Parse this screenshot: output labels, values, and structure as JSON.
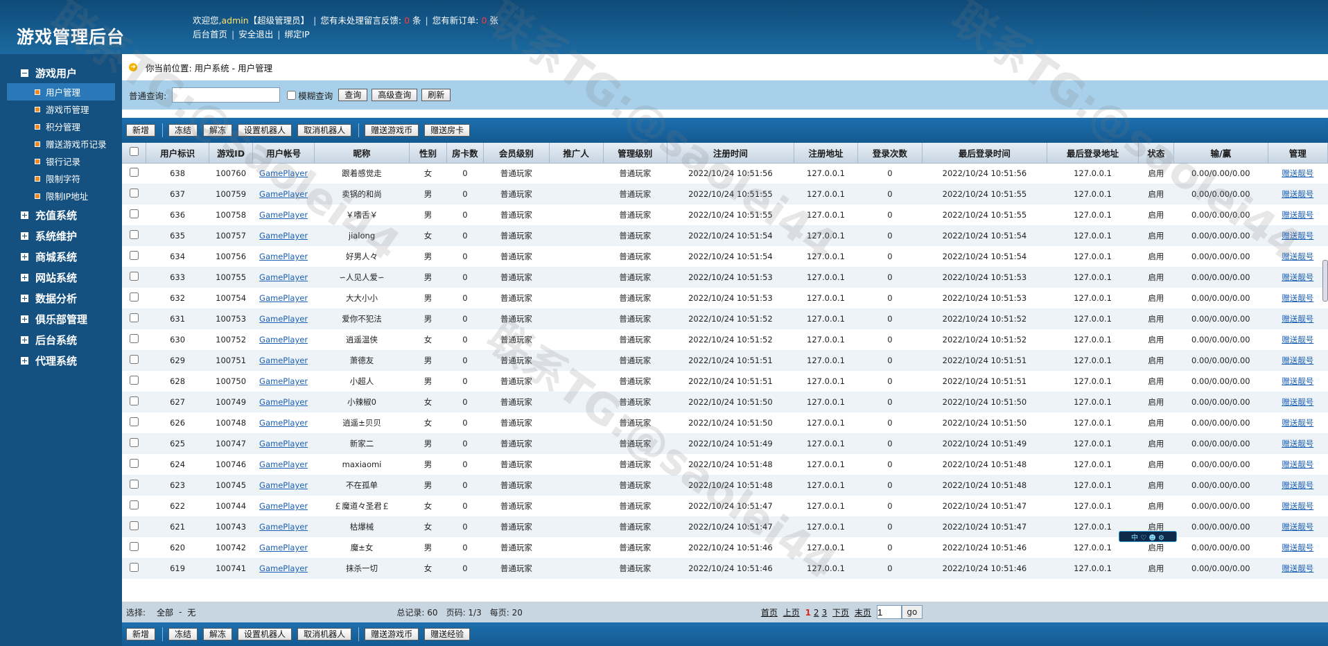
{
  "app_title": "游戏管理后台",
  "topbar": {
    "welcome_prefix": "欢迎您,",
    "username": "admin",
    "role": "【超级管理员】",
    "pending_prefix": "您有未处理留言反馈:",
    "pending_count": "0",
    "pending_unit": "条",
    "orders_prefix": "您有新订单:",
    "orders_count": "0",
    "orders_unit": "张",
    "links": [
      "后台首页",
      "安全退出",
      "绑定IP"
    ]
  },
  "sidebar": {
    "groups": [
      {
        "label": "游戏用户",
        "expanded": true,
        "items": [
          "用户管理",
          "游戏币管理",
          "积分管理",
          "赠送游戏币记录",
          "银行记录",
          "限制字符",
          "限制IP地址"
        ]
      },
      {
        "label": "充值系统",
        "expanded": false
      },
      {
        "label": "系统维护",
        "expanded": false
      },
      {
        "label": "商城系统",
        "expanded": false
      },
      {
        "label": "网站系统",
        "expanded": false
      },
      {
        "label": "数据分析",
        "expanded": false
      },
      {
        "label": "俱乐部管理",
        "expanded": false
      },
      {
        "label": "后台系统",
        "expanded": false
      },
      {
        "label": "代理系统",
        "expanded": false
      }
    ],
    "active_item": "用户管理"
  },
  "breadcrumb": "你当前位置: 用户系统 - 用户管理",
  "search": {
    "label": "普通查询:",
    "value": "",
    "fuzzy_label": "模糊查询",
    "buttons": [
      "查询",
      "高级查询",
      "刷新"
    ]
  },
  "toolbar_top": {
    "left": [
      "新增"
    ],
    "mid": [
      "冻结",
      "解冻",
      "设置机器人",
      "取消机器人"
    ],
    "right": [
      "赠送游戏币",
      "赠送房卡"
    ]
  },
  "toolbar_bottom": {
    "left": [
      "新增"
    ],
    "mid": [
      "冻结",
      "解冻",
      "设置机器人",
      "取消机器人"
    ],
    "right": [
      "赠送游戏币",
      "赠送经验"
    ]
  },
  "table": {
    "columns": [
      "",
      "用户标识",
      "游戏ID",
      "用户帐号",
      "昵称",
      "性别",
      "房卡数",
      "会员级别",
      "推广人",
      "管理级别",
      "注册时间",
      "注册地址",
      "登录次数",
      "最后登录时间",
      "最后登录地址",
      "状态",
      "输/赢",
      "管理"
    ],
    "rows": [
      [
        "638",
        "100760",
        "GamePlayer",
        "跟着感觉走",
        "女",
        "0",
        "普通玩家",
        "",
        "普通玩家",
        "2022/10/24 10:51:56",
        "127.0.0.1",
        "0",
        "2022/10/24 10:51:56",
        "127.0.0.1",
        "启用",
        "0.00/0.00/0.00",
        "赠送靓号"
      ],
      [
        "637",
        "100759",
        "GamePlayer",
        "卖锅的和尚",
        "男",
        "0",
        "普通玩家",
        "",
        "普通玩家",
        "2022/10/24 10:51:55",
        "127.0.0.1",
        "0",
        "2022/10/24 10:51:55",
        "127.0.0.1",
        "启用",
        "0.00/0.00/0.00",
        "赠送靓号"
      ],
      [
        "636",
        "100758",
        "GamePlayer",
        "￥嗜舌￥",
        "男",
        "0",
        "普通玩家",
        "",
        "普通玩家",
        "2022/10/24 10:51:55",
        "127.0.0.1",
        "0",
        "2022/10/24 10:51:55",
        "127.0.0.1",
        "启用",
        "0.00/0.00/0.00",
        "赠送靓号"
      ],
      [
        "635",
        "100757",
        "GamePlayer",
        "jialong",
        "女",
        "0",
        "普通玩家",
        "",
        "普通玩家",
        "2022/10/24 10:51:54",
        "127.0.0.1",
        "0",
        "2022/10/24 10:51:54",
        "127.0.0.1",
        "启用",
        "0.00/0.00/0.00",
        "赠送靓号"
      ],
      [
        "634",
        "100756",
        "GamePlayer",
        "好男人々",
        "男",
        "0",
        "普通玩家",
        "",
        "普通玩家",
        "2022/10/24 10:51:54",
        "127.0.0.1",
        "0",
        "2022/10/24 10:51:54",
        "127.0.0.1",
        "启用",
        "0.00/0.00/0.00",
        "赠送靓号"
      ],
      [
        "633",
        "100755",
        "GamePlayer",
        "∽人见人爱∽",
        "男",
        "0",
        "普通玩家",
        "",
        "普通玩家",
        "2022/10/24 10:51:53",
        "127.0.0.1",
        "0",
        "2022/10/24 10:51:53",
        "127.0.0.1",
        "启用",
        "0.00/0.00/0.00",
        "赠送靓号"
      ],
      [
        "632",
        "100754",
        "GamePlayer",
        "大大小小",
        "男",
        "0",
        "普通玩家",
        "",
        "普通玩家",
        "2022/10/24 10:51:53",
        "127.0.0.1",
        "0",
        "2022/10/24 10:51:53",
        "127.0.0.1",
        "启用",
        "0.00/0.00/0.00",
        "赠送靓号"
      ],
      [
        "631",
        "100753",
        "GamePlayer",
        "爱你不犯法",
        "男",
        "0",
        "普通玩家",
        "",
        "普通玩家",
        "2022/10/24 10:51:52",
        "127.0.0.1",
        "0",
        "2022/10/24 10:51:52",
        "127.0.0.1",
        "启用",
        "0.00/0.00/0.00",
        "赠送靓号"
      ],
      [
        "630",
        "100752",
        "GamePlayer",
        "逍遥温侠",
        "女",
        "0",
        "普通玩家",
        "",
        "普通玩家",
        "2022/10/24 10:51:52",
        "127.0.0.1",
        "0",
        "2022/10/24 10:51:52",
        "127.0.0.1",
        "启用",
        "0.00/0.00/0.00",
        "赠送靓号"
      ],
      [
        "629",
        "100751",
        "GamePlayer",
        "萧德友",
        "男",
        "0",
        "普通玩家",
        "",
        "普通玩家",
        "2022/10/24 10:51:51",
        "127.0.0.1",
        "0",
        "2022/10/24 10:51:51",
        "127.0.0.1",
        "启用",
        "0.00/0.00/0.00",
        "赠送靓号"
      ],
      [
        "628",
        "100750",
        "GamePlayer",
        "小超人",
        "男",
        "0",
        "普通玩家",
        "",
        "普通玩家",
        "2022/10/24 10:51:51",
        "127.0.0.1",
        "0",
        "2022/10/24 10:51:51",
        "127.0.0.1",
        "启用",
        "0.00/0.00/0.00",
        "赠送靓号"
      ],
      [
        "627",
        "100749",
        "GamePlayer",
        "小辣椒0",
        "女",
        "0",
        "普通玩家",
        "",
        "普通玩家",
        "2022/10/24 10:51:50",
        "127.0.0.1",
        "0",
        "2022/10/24 10:51:50",
        "127.0.0.1",
        "启用",
        "0.00/0.00/0.00",
        "赠送靓号"
      ],
      [
        "626",
        "100748",
        "GamePlayer",
        "逍遥±贝贝",
        "女",
        "0",
        "普通玩家",
        "",
        "普通玩家",
        "2022/10/24 10:51:50",
        "127.0.0.1",
        "0",
        "2022/10/24 10:51:50",
        "127.0.0.1",
        "启用",
        "0.00/0.00/0.00",
        "赠送靓号"
      ],
      [
        "625",
        "100747",
        "GamePlayer",
        "新家二",
        "男",
        "0",
        "普通玩家",
        "",
        "普通玩家",
        "2022/10/24 10:51:49",
        "127.0.0.1",
        "0",
        "2022/10/24 10:51:49",
        "127.0.0.1",
        "启用",
        "0.00/0.00/0.00",
        "赠送靓号"
      ],
      [
        "624",
        "100746",
        "GamePlayer",
        "maxiaomi",
        "男",
        "0",
        "普通玩家",
        "",
        "普通玩家",
        "2022/10/24 10:51:48",
        "127.0.0.1",
        "0",
        "2022/10/24 10:51:48",
        "127.0.0.1",
        "启用",
        "0.00/0.00/0.00",
        "赠送靓号"
      ],
      [
        "623",
        "100745",
        "GamePlayer",
        "不在孤单",
        "男",
        "0",
        "普通玩家",
        "",
        "普通玩家",
        "2022/10/24 10:51:48",
        "127.0.0.1",
        "0",
        "2022/10/24 10:51:48",
        "127.0.0.1",
        "启用",
        "0.00/0.00/0.00",
        "赠送靓号"
      ],
      [
        "622",
        "100744",
        "GamePlayer",
        "￡魔道々圣君￡",
        "女",
        "0",
        "普通玩家",
        "",
        "普通玩家",
        "2022/10/24 10:51:47",
        "127.0.0.1",
        "0",
        "2022/10/24 10:51:47",
        "127.0.0.1",
        "启用",
        "0.00/0.00/0.00",
        "赠送靓号"
      ],
      [
        "621",
        "100743",
        "GamePlayer",
        "枯爆械",
        "女",
        "0",
        "普通玩家",
        "",
        "普通玩家",
        "2022/10/24 10:51:47",
        "127.0.0.1",
        "0",
        "2022/10/24 10:51:47",
        "127.0.0.1",
        "启用",
        "0.00/0.00/0.00",
        "赠送靓号"
      ],
      [
        "620",
        "100742",
        "GamePlayer",
        "魔±女",
        "男",
        "0",
        "普通玩家",
        "",
        "普通玩家",
        "2022/10/24 10:51:46",
        "127.0.0.1",
        "0",
        "2022/10/24 10:51:46",
        "127.0.0.1",
        "启用",
        "0.00/0.00/0.00",
        "赠送靓号"
      ],
      [
        "619",
        "100741",
        "GamePlayer",
        "抹杀一切",
        "女",
        "0",
        "普通玩家",
        "",
        "普通玩家",
        "2022/10/24 10:51:46",
        "127.0.0.1",
        "0",
        "2022/10/24 10:51:46",
        "127.0.0.1",
        "启用",
        "0.00/0.00/0.00",
        "赠送靓号"
      ]
    ]
  },
  "footer": {
    "select_label": "选择:",
    "select_all": "全部",
    "select_dash": "-",
    "select_none": "无",
    "total_label": "总记录: 60",
    "page_label": "页码: 1/3",
    "per_page_label": "每页: 20",
    "nav": [
      "首页",
      "上页"
    ],
    "pages": [
      "1",
      "2",
      "3"
    ],
    "nav_after": [
      "下页",
      "末页"
    ],
    "page_input": "1",
    "go_label": "go"
  },
  "float_badge": "中 ♡ ☻ ⚙",
  "watermark_texts": [
    "联系TG:@saolei44",
    "联系TG:@saolei44",
    "联系TG:@saolei44",
    "联系TG:@saolei44"
  ]
}
